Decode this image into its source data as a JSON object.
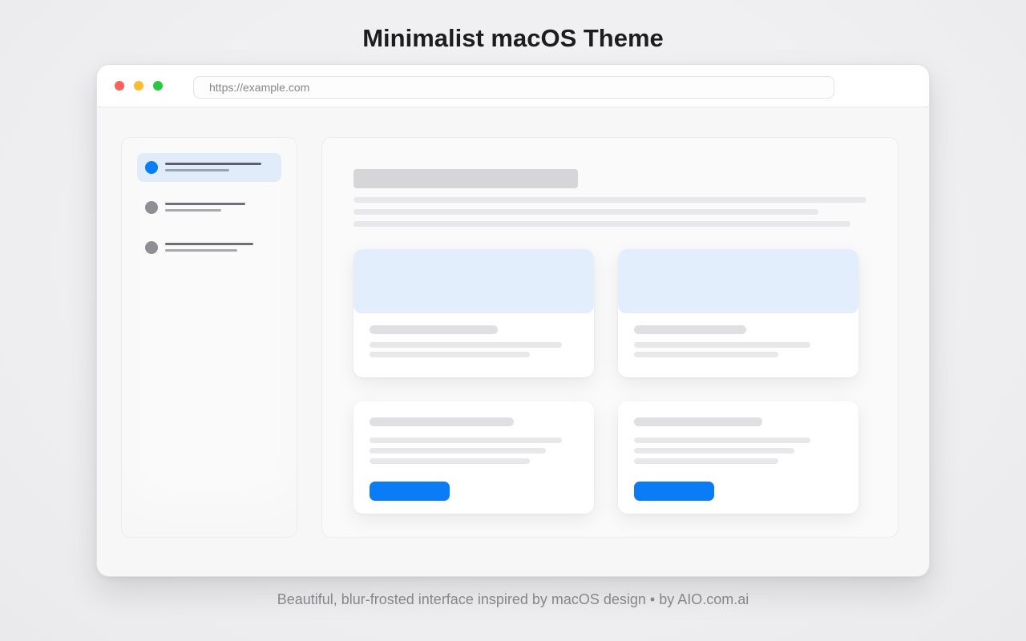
{
  "page": {
    "title": "Minimalist macOS Theme",
    "footer": "Beautiful, blur-frosted interface inspired by macOS design • by AIO.com.ai"
  },
  "window": {
    "controls": [
      "close-dot",
      "minimize-dot",
      "maximize-dot"
    ],
    "url": "https://example.com"
  },
  "sidebar": {
    "active_index": 0,
    "items": 3
  },
  "colors": {
    "accent": "#0a7cf5",
    "close": "#ff5f57",
    "minimize": "#febc2e",
    "maximize": "#28c840",
    "active_bg": "#e1ecfb",
    "card_banner": "#e3eefc"
  }
}
